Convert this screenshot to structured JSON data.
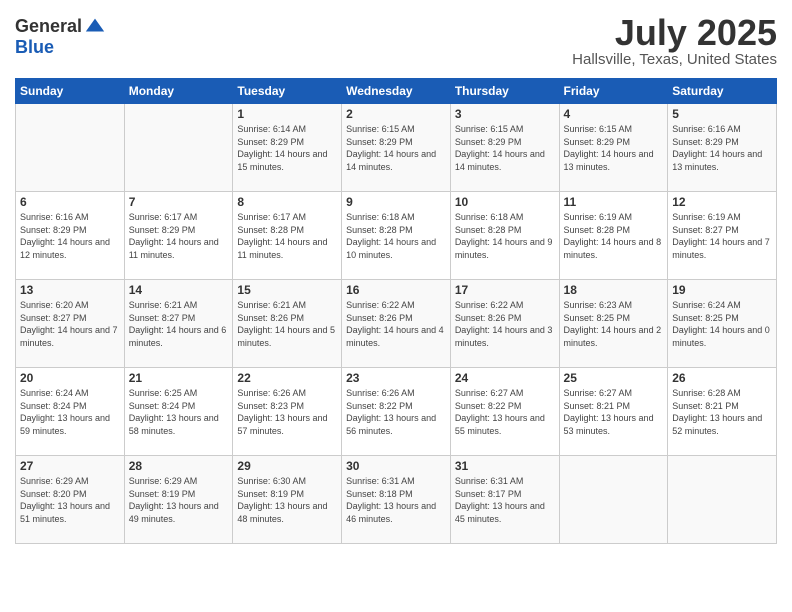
{
  "header": {
    "logo_general": "General",
    "logo_blue": "Blue",
    "month_title": "July 2025",
    "location": "Hallsville, Texas, United States"
  },
  "weekdays": [
    "Sunday",
    "Monday",
    "Tuesday",
    "Wednesday",
    "Thursday",
    "Friday",
    "Saturday"
  ],
  "weeks": [
    [
      {
        "day": "",
        "sunrise": "",
        "sunset": "",
        "daylight": ""
      },
      {
        "day": "",
        "sunrise": "",
        "sunset": "",
        "daylight": ""
      },
      {
        "day": "1",
        "sunrise": "Sunrise: 6:14 AM",
        "sunset": "Sunset: 8:29 PM",
        "daylight": "Daylight: 14 hours and 15 minutes."
      },
      {
        "day": "2",
        "sunrise": "Sunrise: 6:15 AM",
        "sunset": "Sunset: 8:29 PM",
        "daylight": "Daylight: 14 hours and 14 minutes."
      },
      {
        "day": "3",
        "sunrise": "Sunrise: 6:15 AM",
        "sunset": "Sunset: 8:29 PM",
        "daylight": "Daylight: 14 hours and 14 minutes."
      },
      {
        "day": "4",
        "sunrise": "Sunrise: 6:15 AM",
        "sunset": "Sunset: 8:29 PM",
        "daylight": "Daylight: 14 hours and 13 minutes."
      },
      {
        "day": "5",
        "sunrise": "Sunrise: 6:16 AM",
        "sunset": "Sunset: 8:29 PM",
        "daylight": "Daylight: 14 hours and 13 minutes."
      }
    ],
    [
      {
        "day": "6",
        "sunrise": "Sunrise: 6:16 AM",
        "sunset": "Sunset: 8:29 PM",
        "daylight": "Daylight: 14 hours and 12 minutes."
      },
      {
        "day": "7",
        "sunrise": "Sunrise: 6:17 AM",
        "sunset": "Sunset: 8:29 PM",
        "daylight": "Daylight: 14 hours and 11 minutes."
      },
      {
        "day": "8",
        "sunrise": "Sunrise: 6:17 AM",
        "sunset": "Sunset: 8:28 PM",
        "daylight": "Daylight: 14 hours and 11 minutes."
      },
      {
        "day": "9",
        "sunrise": "Sunrise: 6:18 AM",
        "sunset": "Sunset: 8:28 PM",
        "daylight": "Daylight: 14 hours and 10 minutes."
      },
      {
        "day": "10",
        "sunrise": "Sunrise: 6:18 AM",
        "sunset": "Sunset: 8:28 PM",
        "daylight": "Daylight: 14 hours and 9 minutes."
      },
      {
        "day": "11",
        "sunrise": "Sunrise: 6:19 AM",
        "sunset": "Sunset: 8:28 PM",
        "daylight": "Daylight: 14 hours and 8 minutes."
      },
      {
        "day": "12",
        "sunrise": "Sunrise: 6:19 AM",
        "sunset": "Sunset: 8:27 PM",
        "daylight": "Daylight: 14 hours and 7 minutes."
      }
    ],
    [
      {
        "day": "13",
        "sunrise": "Sunrise: 6:20 AM",
        "sunset": "Sunset: 8:27 PM",
        "daylight": "Daylight: 14 hours and 7 minutes."
      },
      {
        "day": "14",
        "sunrise": "Sunrise: 6:21 AM",
        "sunset": "Sunset: 8:27 PM",
        "daylight": "Daylight: 14 hours and 6 minutes."
      },
      {
        "day": "15",
        "sunrise": "Sunrise: 6:21 AM",
        "sunset": "Sunset: 8:26 PM",
        "daylight": "Daylight: 14 hours and 5 minutes."
      },
      {
        "day": "16",
        "sunrise": "Sunrise: 6:22 AM",
        "sunset": "Sunset: 8:26 PM",
        "daylight": "Daylight: 14 hours and 4 minutes."
      },
      {
        "day": "17",
        "sunrise": "Sunrise: 6:22 AM",
        "sunset": "Sunset: 8:26 PM",
        "daylight": "Daylight: 14 hours and 3 minutes."
      },
      {
        "day": "18",
        "sunrise": "Sunrise: 6:23 AM",
        "sunset": "Sunset: 8:25 PM",
        "daylight": "Daylight: 14 hours and 2 minutes."
      },
      {
        "day": "19",
        "sunrise": "Sunrise: 6:24 AM",
        "sunset": "Sunset: 8:25 PM",
        "daylight": "Daylight: 14 hours and 0 minutes."
      }
    ],
    [
      {
        "day": "20",
        "sunrise": "Sunrise: 6:24 AM",
        "sunset": "Sunset: 8:24 PM",
        "daylight": "Daylight: 13 hours and 59 minutes."
      },
      {
        "day": "21",
        "sunrise": "Sunrise: 6:25 AM",
        "sunset": "Sunset: 8:24 PM",
        "daylight": "Daylight: 13 hours and 58 minutes."
      },
      {
        "day": "22",
        "sunrise": "Sunrise: 6:26 AM",
        "sunset": "Sunset: 8:23 PM",
        "daylight": "Daylight: 13 hours and 57 minutes."
      },
      {
        "day": "23",
        "sunrise": "Sunrise: 6:26 AM",
        "sunset": "Sunset: 8:22 PM",
        "daylight": "Daylight: 13 hours and 56 minutes."
      },
      {
        "day": "24",
        "sunrise": "Sunrise: 6:27 AM",
        "sunset": "Sunset: 8:22 PM",
        "daylight": "Daylight: 13 hours and 55 minutes."
      },
      {
        "day": "25",
        "sunrise": "Sunrise: 6:27 AM",
        "sunset": "Sunset: 8:21 PM",
        "daylight": "Daylight: 13 hours and 53 minutes."
      },
      {
        "day": "26",
        "sunrise": "Sunrise: 6:28 AM",
        "sunset": "Sunset: 8:21 PM",
        "daylight": "Daylight: 13 hours and 52 minutes."
      }
    ],
    [
      {
        "day": "27",
        "sunrise": "Sunrise: 6:29 AM",
        "sunset": "Sunset: 8:20 PM",
        "daylight": "Daylight: 13 hours and 51 minutes."
      },
      {
        "day": "28",
        "sunrise": "Sunrise: 6:29 AM",
        "sunset": "Sunset: 8:19 PM",
        "daylight": "Daylight: 13 hours and 49 minutes."
      },
      {
        "day": "29",
        "sunrise": "Sunrise: 6:30 AM",
        "sunset": "Sunset: 8:19 PM",
        "daylight": "Daylight: 13 hours and 48 minutes."
      },
      {
        "day": "30",
        "sunrise": "Sunrise: 6:31 AM",
        "sunset": "Sunset: 8:18 PM",
        "daylight": "Daylight: 13 hours and 46 minutes."
      },
      {
        "day": "31",
        "sunrise": "Sunrise: 6:31 AM",
        "sunset": "Sunset: 8:17 PM",
        "daylight": "Daylight: 13 hours and 45 minutes."
      },
      {
        "day": "",
        "sunrise": "",
        "sunset": "",
        "daylight": ""
      },
      {
        "day": "",
        "sunrise": "",
        "sunset": "",
        "daylight": ""
      }
    ]
  ]
}
